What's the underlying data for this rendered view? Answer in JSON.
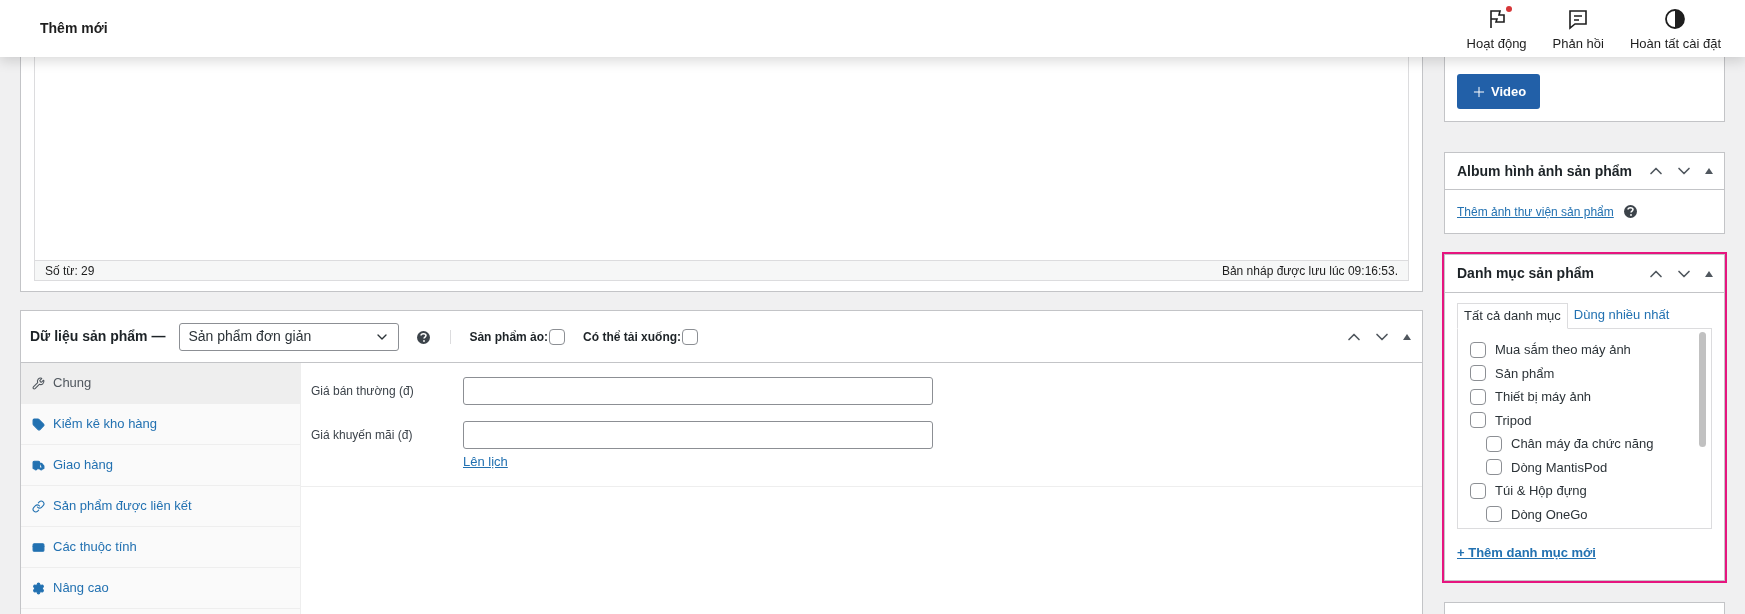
{
  "header": {
    "title": "Thêm mới",
    "actions": [
      {
        "label": "Hoạt động",
        "has_dot": true
      },
      {
        "label": "Phản hồi",
        "has_dot": false
      },
      {
        "label": "Hoàn tất cài đặt",
        "has_dot": false
      }
    ]
  },
  "editor": {
    "word_count": "Số từ: 29",
    "draft_status": "Bản nháp được lưu lúc 09:16:53."
  },
  "product_data": {
    "title": "Dữ liệu sản phẩm —",
    "type_select": "Sản phẩm đơn giản",
    "options": [
      {
        "label": "Sản phẩm ảo:",
        "checked": false
      },
      {
        "label": "Có thể tải xuống:",
        "checked": false
      }
    ],
    "tabs": [
      {
        "label": "Chung",
        "selected": true
      },
      {
        "label": "Kiểm kê kho hàng",
        "selected": false
      },
      {
        "label": "Giao hàng",
        "selected": false
      },
      {
        "label": "Sản phẩm được liên kết",
        "selected": false
      },
      {
        "label": "Các thuộc tính",
        "selected": false
      },
      {
        "label": "Nâng cao",
        "selected": false
      }
    ],
    "fields": [
      {
        "label": "Giá bán thường (đ)"
      },
      {
        "label": "Giá khuyến mãi (đ)"
      }
    ],
    "schedule_link": "Lên lịch"
  },
  "sidebar": {
    "video_button": "Video",
    "album": {
      "title": "Album hình ảnh sản phẩm",
      "link": "Thêm ảnh thư viện sản phẩm"
    },
    "categories": {
      "title": "Danh mục sản phẩm",
      "highlighted": true,
      "tabs": [
        {
          "label": "Tất cả danh mục",
          "selected": true
        },
        {
          "label": "Dùng nhiều nhất",
          "selected": false
        }
      ],
      "items": [
        {
          "label": "Mua sắm theo máy ảnh",
          "checked": false
        },
        {
          "label": "Sản phẩm",
          "checked": false
        },
        {
          "label": "Thiết bị máy ảnh",
          "checked": false
        },
        {
          "label": "Tripod",
          "checked": false,
          "children": [
            {
              "label": "Chân máy đa chức năng",
              "checked": false
            },
            {
              "label": "Dòng MantisPod",
              "checked": false
            }
          ]
        },
        {
          "label": "Túi & Hộp đựng",
          "checked": false,
          "children": [
            {
              "label": "Dòng OneGo",
              "checked": false
            }
          ]
        }
      ],
      "add_link": "+ Thêm danh mục mới"
    }
  }
}
